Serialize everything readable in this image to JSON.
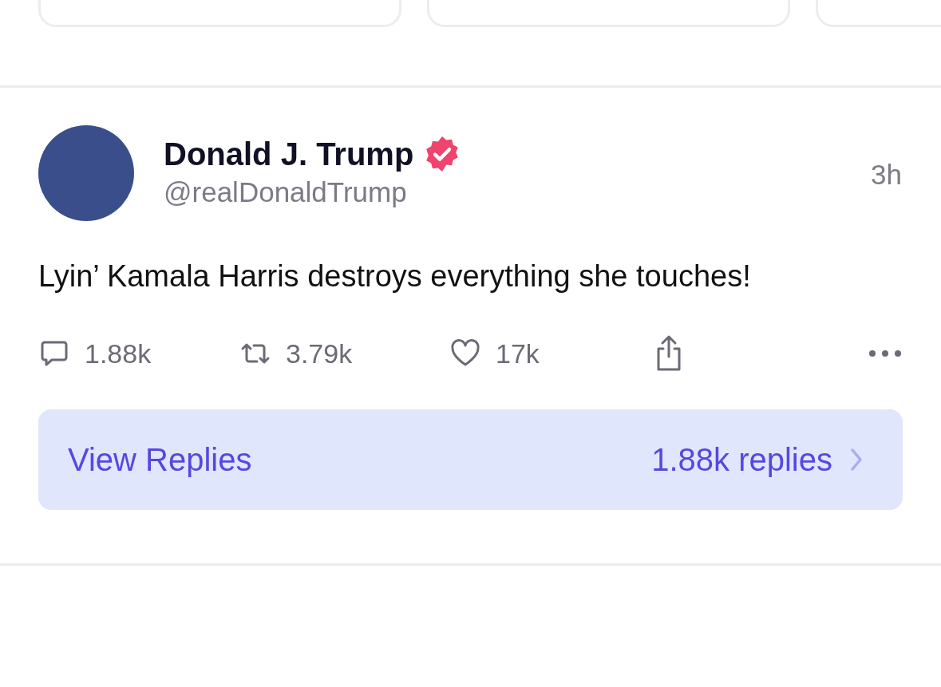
{
  "post": {
    "author": "Donald J. Trump",
    "verified": true,
    "handle": "@realDonaldTrump",
    "time": "3h",
    "text": "Lyin’ Kamala Harris destroys everything she touches!",
    "actions": [
      {
        "kind": "reply",
        "count": "1.88k"
      },
      {
        "kind": "repost",
        "count": "3.79k"
      },
      {
        "kind": "like",
        "count": "17k"
      },
      {
        "kind": "share"
      }
    ],
    "replies_bar": {
      "label": "View Replies",
      "count": "1.88k replies"
    }
  }
}
